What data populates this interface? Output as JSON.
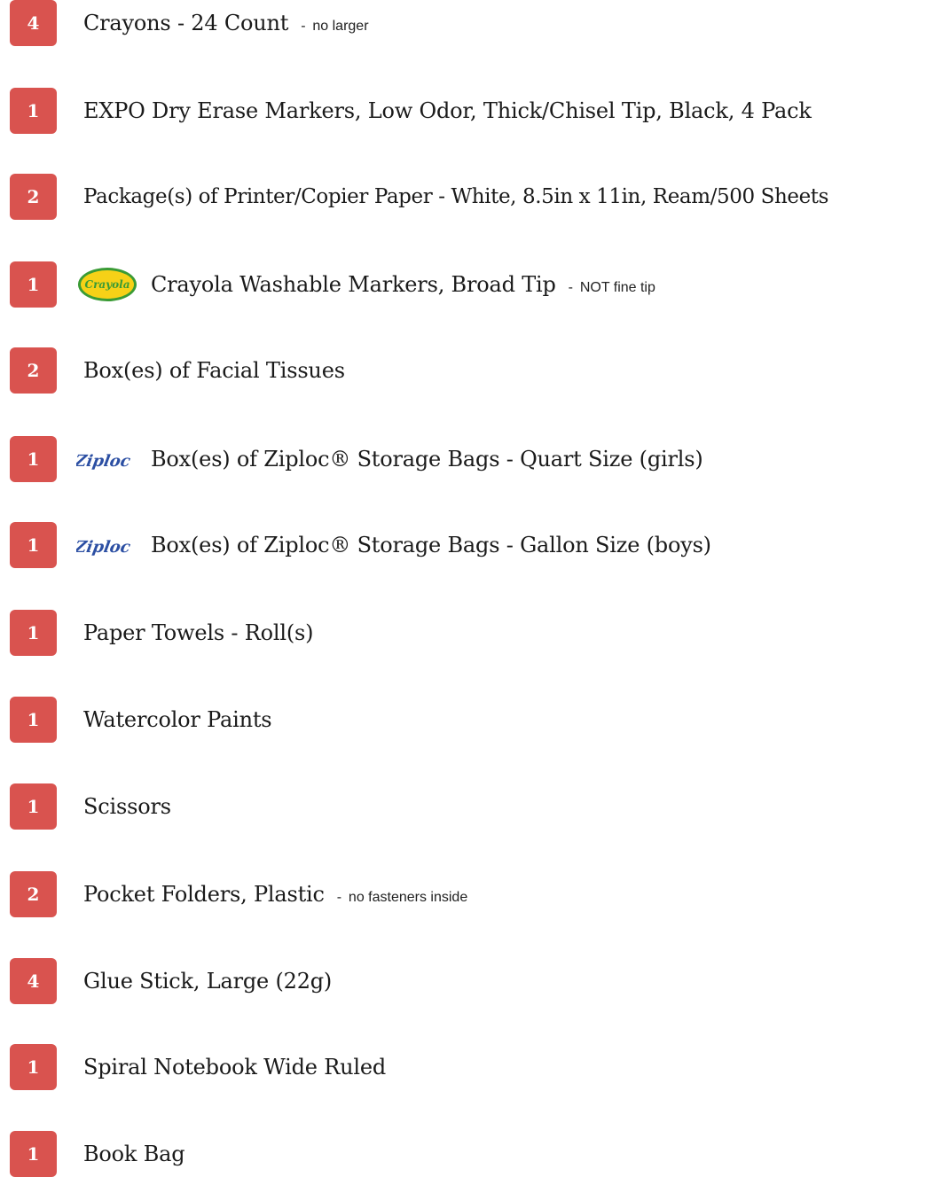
{
  "items": [
    {
      "qty": "4",
      "name": "Crayons - 24 Count",
      "note": "no larger",
      "logo": ""
    },
    {
      "qty": "1",
      "name": "EXPO Dry Erase Markers, Low Odor, Thick/Chisel Tip, Black, 4 Pack",
      "note": "",
      "logo": ""
    },
    {
      "qty": "2",
      "name": "Package(s) of Printer/Copier Paper - White, 8.5in x 11in, Ream/500 Sheets",
      "note": "",
      "logo": ""
    },
    {
      "qty": "1",
      "name": "Crayola Washable Markers, Broad Tip",
      "note": "NOT fine tip",
      "logo": "crayola-logo",
      "logo_text": "Crayola"
    },
    {
      "qty": "2",
      "name": "Box(es) of Facial Tissues",
      "note": "",
      "logo": ""
    },
    {
      "qty": "1",
      "name": "Box(es) of Ziploc® Storage Bags - Quart Size (girls)",
      "note": "",
      "logo": "ziploc-logo",
      "logo_text": "Ziploc"
    },
    {
      "qty": "1",
      "name": "Box(es) of Ziploc® Storage Bags - Gallon Size (boys)",
      "note": "",
      "logo": "ziploc-logo",
      "logo_text": "Ziploc"
    },
    {
      "qty": "1",
      "name": "Paper Towels - Roll(s)",
      "note": "",
      "logo": ""
    },
    {
      "qty": "1",
      "name": "Watercolor Paints",
      "note": "",
      "logo": ""
    },
    {
      "qty": "1",
      "name": "Scissors",
      "note": "",
      "logo": ""
    },
    {
      "qty": "2",
      "name": "Pocket Folders, Plastic",
      "note": "no fasteners inside",
      "logo": ""
    },
    {
      "qty": "4",
      "name": "Glue Stick, Large (22g)",
      "note": "",
      "logo": ""
    },
    {
      "qty": "1",
      "name": "Spiral Notebook Wide Ruled",
      "note": "",
      "logo": ""
    },
    {
      "qty": "1",
      "name": "Book Bag",
      "note": "",
      "logo": ""
    }
  ],
  "separator": "-",
  "colors": {
    "qty_badge": "#d9534f",
    "text": "#1a1a1a",
    "crayola_yellow": "#f6d117",
    "crayola_green": "#3a9b35",
    "ziploc_blue": "#2c4fa3"
  }
}
